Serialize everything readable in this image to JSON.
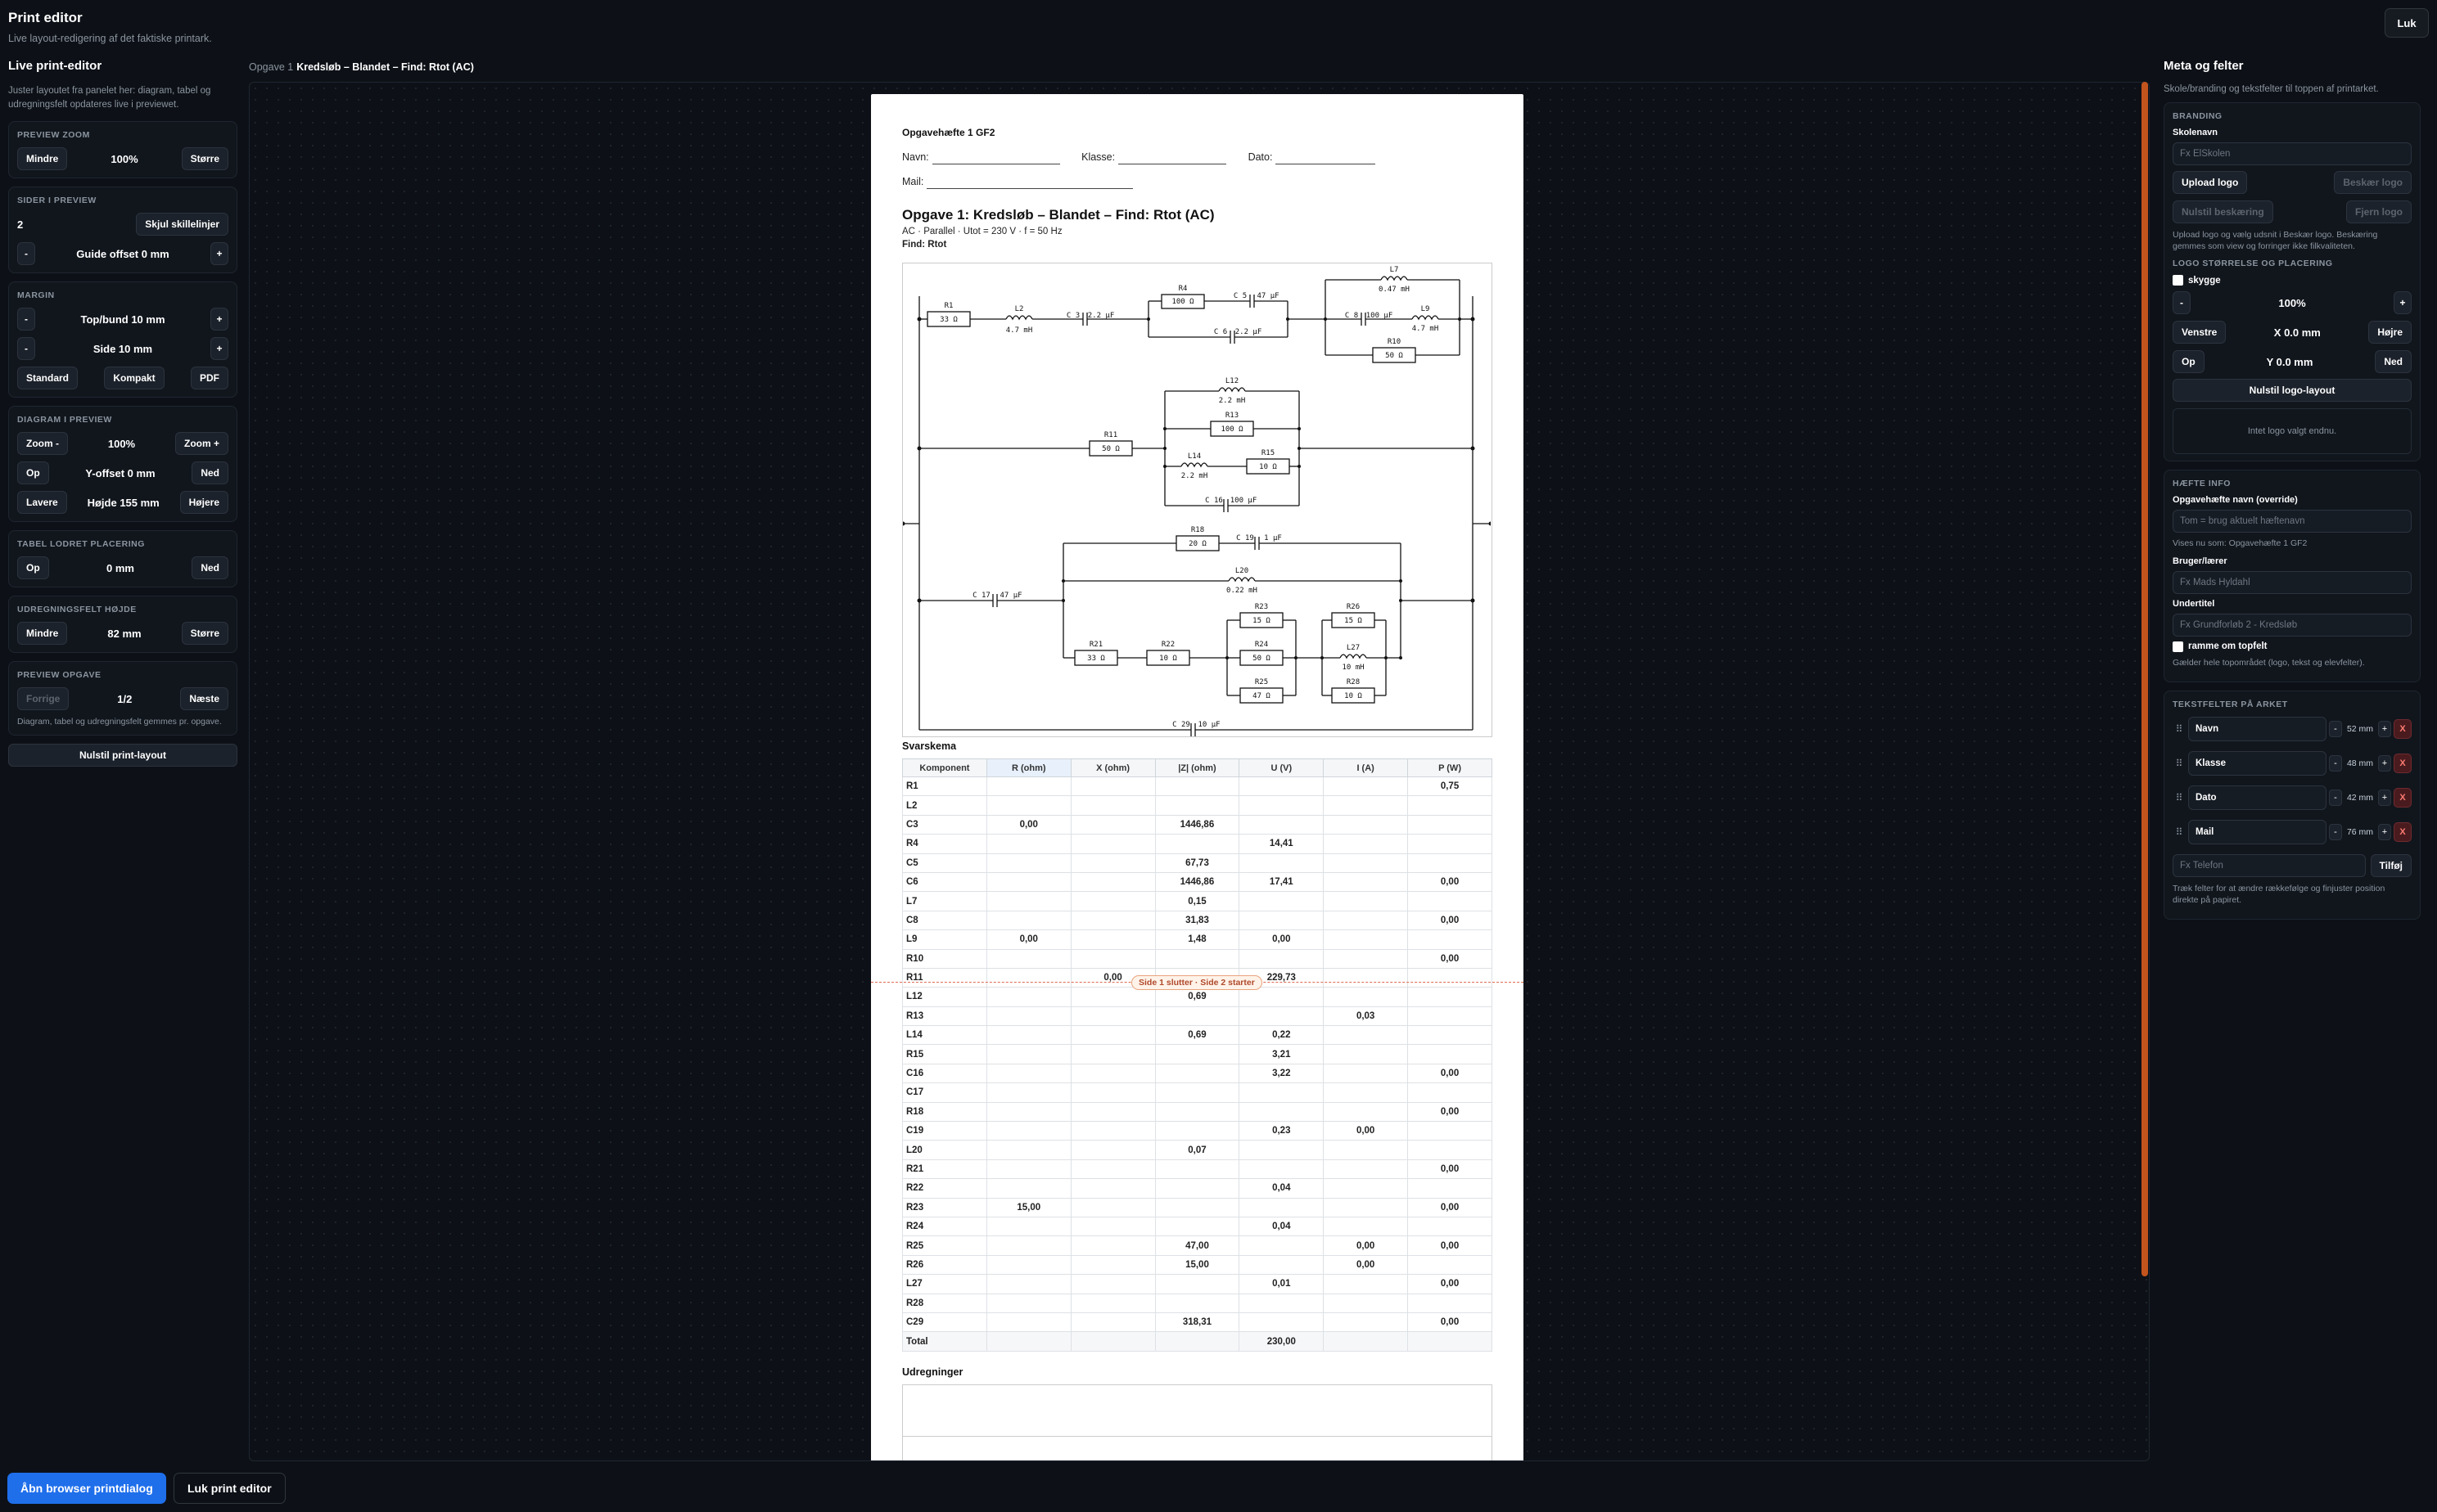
{
  "header": {
    "title": "Print editor",
    "subtitle": "Live layout-redigering af det faktiske printark.",
    "close_label": "Luk"
  },
  "left": {
    "title": "Live print-editor",
    "intro": "Juster layoutet fra panelet her: diagram, tabel og udregningsfelt opdateres live i previewet.",
    "zoom": {
      "title": "Preview zoom",
      "smaller": "Mindre",
      "value": "100%",
      "bigger": "Større"
    },
    "pages": {
      "title": "Sider i preview",
      "count": "2",
      "hide": "Skjul skillelinjer",
      "minus": "-",
      "guide": "Guide offset 0 mm",
      "plus": "+"
    },
    "margin": {
      "title": "Margin",
      "minus": "-",
      "plus": "+",
      "topbottom": "Top/bund 10 mm",
      "side": "Side 10 mm",
      "standard": "Standard",
      "compact": "Kompakt",
      "pdf": "PDF"
    },
    "diagram": {
      "title": "Diagram i preview",
      "zoom_out": "Zoom -",
      "zoom_val": "100%",
      "zoom_in": "Zoom +",
      "up": "Op",
      "yoff": "Y-offset 0 mm",
      "down": "Ned",
      "lower": "Lavere",
      "height": "Højde 155 mm",
      "higher": "Højere"
    },
    "table": {
      "title": "Tabel lodret placering",
      "up": "Op",
      "val": "0 mm",
      "down": "Ned"
    },
    "calc": {
      "title": "Udregningsfelt højde",
      "smaller": "Mindre",
      "val": "82 mm",
      "bigger": "Større"
    },
    "task": {
      "title": "Preview opgave",
      "prev": "Forrige",
      "val": "1/2",
      "next": "Næste",
      "note": "Diagram, tabel og udregningsfelt gemmes pr. opgave."
    },
    "reset": "Nulstil print-layout"
  },
  "crumb": {
    "label": "Opgave 1",
    "title": "Kredsløb – Blandet – Find: Rtot (AC)"
  },
  "paper": {
    "heading": "Opgavehæfte 1 GF2",
    "fields": {
      "name": "Navn:",
      "class": "Klasse:",
      "date": "Dato:",
      "mail": "Mail:"
    },
    "title": "Opgave 1: Kredsløb – Blandet – Find: Rtot (AC)",
    "subtitle": "AC · Parallel · Utot = 230 V · f = 50 Hz",
    "find": "Find: Rtot",
    "answers_title": "Svarskema",
    "columns": [
      "Komponent",
      "R (ohm)",
      "X (ohm)",
      "|Z| (ohm)",
      "U (V)",
      "I (A)",
      "P (W)"
    ],
    "rows": [
      [
        "R1",
        "",
        "",
        "",
        "",
        "",
        "0,75"
      ],
      [
        "L2",
        "",
        "",
        "",
        "",
        "",
        ""
      ],
      [
        "C3",
        "0,00",
        "",
        "1446,86",
        "",
        "",
        ""
      ],
      [
        "R4",
        "",
        "",
        "",
        "14,41",
        "",
        ""
      ],
      [
        "C5",
        "",
        "",
        "67,73",
        "",
        "",
        ""
      ],
      [
        "C6",
        "",
        "",
        "1446,86",
        "17,41",
        "",
        "0,00"
      ],
      [
        "L7",
        "",
        "",
        "0,15",
        "",
        "",
        ""
      ],
      [
        "C8",
        "",
        "",
        "31,83",
        "",
        "",
        "0,00"
      ],
      [
        "L9",
        "0,00",
        "",
        "1,48",
        "0,00",
        "",
        ""
      ],
      [
        "R10",
        "",
        "",
        "",
        "",
        "",
        "0,00"
      ],
      [
        "R11",
        "",
        "0,00",
        "",
        "229,73",
        "",
        ""
      ],
      [
        "L12",
        "",
        "",
        "0,69",
        "",
        "",
        ""
      ],
      [
        "R13",
        "",
        "",
        "",
        "",
        "0,03",
        ""
      ],
      [
        "L14",
        "",
        "",
        "0,69",
        "0,22",
        "",
        ""
      ],
      [
        "R15",
        "",
        "",
        "",
        "3,21",
        "",
        ""
      ],
      [
        "C16",
        "",
        "",
        "",
        "3,22",
        "",
        "0,00"
      ],
      [
        "C17",
        "",
        "",
        "",
        "",
        "",
        ""
      ],
      [
        "R18",
        "",
        "",
        "",
        "",
        "",
        "0,00"
      ],
      [
        "C19",
        "",
        "",
        "",
        "0,23",
        "0,00",
        ""
      ],
      [
        "L20",
        "",
        "",
        "0,07",
        "",
        "",
        ""
      ],
      [
        "R21",
        "",
        "",
        "",
        "",
        "",
        "0,00"
      ],
      [
        "R22",
        "",
        "",
        "",
        "0,04",
        "",
        ""
      ],
      [
        "R23",
        "15,00",
        "",
        "",
        "",
        "",
        "0,00"
      ],
      [
        "R24",
        "",
        "",
        "",
        "0,04",
        "",
        ""
      ],
      [
        "R25",
        "",
        "",
        "47,00",
        "",
        "0,00",
        "0,00"
      ],
      [
        "R26",
        "",
        "",
        "15,00",
        "",
        "0,00",
        ""
      ],
      [
        "L27",
        "",
        "",
        "",
        "0,01",
        "",
        "0,00"
      ],
      [
        "R28",
        "",
        "",
        "",
        "",
        "",
        ""
      ],
      [
        "C29",
        "",
        "",
        "318,31",
        "",
        "",
        "0,00"
      ],
      [
        "Total",
        "",
        "",
        "",
        "230,00",
        "",
        ""
      ]
    ],
    "break_label": "Side 1 slutter · Side 2 starter",
    "calc_title": "Udregninger"
  },
  "diagram_labels": {
    "R1": "R1",
    "R1v": "33 Ω",
    "L2": "L2",
    "L2v": "4.7 mH",
    "C3": "C 3",
    "C3v": "2.2 µF",
    "R4": "R4",
    "R4v": "100 Ω",
    "C5": "C 5",
    "C5v": "47 µF",
    "C6": "C 6",
    "C6v": "2.2 µF",
    "L7": "L7",
    "L7v": "0.47 mH",
    "C8": "C 8",
    "C8v": "100 µF",
    "L9": "L9",
    "L9v": "4.7 mH",
    "R10": "R10",
    "R10v": "50 Ω",
    "R11": "R11",
    "R11v": "50 Ω",
    "L12": "L12",
    "L12v": "2.2 mH",
    "R13": "R13",
    "R13v": "100 Ω",
    "L14": "L14",
    "L14v": "2.2 mH",
    "R15": "R15",
    "R15v": "10 Ω",
    "C16": "C 16",
    "C16v": "100 µF",
    "R18": "R18",
    "R18v": "20 Ω",
    "C19": "C 19",
    "C19v": "1 µF",
    "L20": "L20",
    "L20v": "0.22 mH",
    "C17": "C 17",
    "C17v": "47 µF",
    "R21": "R21",
    "R21v": "33 Ω",
    "R22": "R22",
    "R22v": "10 Ω",
    "R23": "R23",
    "R23v": "15 Ω",
    "R24": "R24",
    "R24v": "50 Ω",
    "R25": "R25",
    "R25v": "47 Ω",
    "R26": "R26",
    "R26v": "15 Ω",
    "L27": "L27",
    "L27v": "10 mH",
    "R28": "R28",
    "R28v": "10 Ω",
    "C29": "C 29",
    "C29v": "10 µF"
  },
  "right": {
    "title": "Meta og felter",
    "intro": "Skole/branding og tekstfelter til toppen af printarket.",
    "branding": {
      "title": "Branding",
      "school_label": "Skolenavn",
      "school_ph": "Fx ElSkolen",
      "upload": "Upload logo",
      "crop": "Beskær logo",
      "reset_crop": "Nulstil beskæring",
      "remove": "Fjern logo",
      "hint": "Upload logo og vælg udsnit i Beskær logo. Beskæring gemmes som view og forringer ikke filkvaliteten."
    },
    "logo": {
      "title": "Logo størrelse og placering",
      "shadow": "skygge",
      "minus": "-",
      "val": "100%",
      "plus": "+",
      "left": "Venstre",
      "x": "X 0.0 mm",
      "right": "Højre",
      "up": "Op",
      "y": "Y 0.0 mm",
      "down": "Ned",
      "reset": "Nulstil logo-layout",
      "empty": "Intet logo valgt endnu."
    },
    "booklet": {
      "title": "Hæfte info",
      "name_label": "Opgavehæfte navn (override)",
      "name_ph": "Tom = brug aktuelt hæftenavn",
      "name_hint": "Vises nu som: Opgavehæfte 1 GF2",
      "user_label": "Bruger/lærer",
      "user_ph": "Fx Mads Hyldahl",
      "sub_label": "Undertitel",
      "sub_ph": "Fx Grundforløb 2 - Kredsløb",
      "frame": "ramme om topfelt",
      "frame_hint": "Gælder hele topområdet (logo, tekst og elevfelter)."
    },
    "textfields": {
      "title": "Tekstfelter på arket",
      "items": [
        {
          "label": "Navn",
          "mm": "52 mm"
        },
        {
          "label": "Klasse",
          "mm": "48 mm"
        },
        {
          "label": "Dato",
          "mm": "42 mm"
        },
        {
          "label": "Mail",
          "mm": "76 mm"
        }
      ],
      "new_ph": "Fx Telefon",
      "add": "Tilføj",
      "hint": "Træk felter for at ændre rækkefølge og finjuster position direkte på papiret."
    }
  },
  "footer": {
    "print": "Åbn browser printdialog",
    "close": "Luk print editor"
  },
  "colors": {
    "accent": "#1f6feb",
    "scroll": "#c2541e",
    "bg": "#0d1117"
  }
}
